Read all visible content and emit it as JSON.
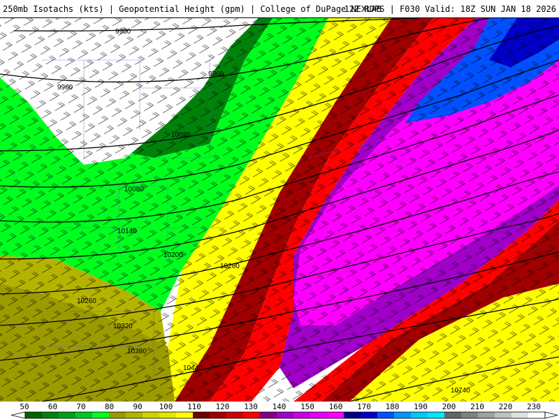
{
  "header": {
    "title_left": "250mb Isotachs (kts) | Geopotential Height (gpm) | College of DuPage NEXLAB",
    "title_right": "12Z RDPS | F030 Valid: 18Z SUN JAN 18 2026"
  },
  "legend": {
    "labels": [
      "50",
      "60",
      "70",
      "80",
      "90",
      "100",
      "110",
      "120",
      "130",
      "140",
      "150",
      "160",
      "170",
      "180",
      "190",
      "200",
      "210",
      "220",
      "230"
    ],
    "colors": [
      "#006400",
      "#00820a",
      "#00a014",
      "#00c81e",
      "#00ff1e",
      "#9b9b00",
      "#b4b400",
      "#d2d200",
      "#e6e600",
      "#ffff00",
      "#6e0000",
      "#a00000",
      "#d20000",
      "#ff0000",
      "#800080",
      "#a000c8",
      "#c800e6",
      "#e600ff",
      "#ff00ff",
      "#000080",
      "#0000c8",
      "#0050ff",
      "#0096ff",
      "#00c8ff",
      "#00e6ff",
      "#646464",
      "#808080",
      "#a0a0a0",
      "#c0c0c0",
      "#e0e0e0",
      "#ffffff"
    ]
  },
  "contours": {
    "labels": [
      "9900",
      "9960",
      "9960",
      "10020",
      "10080",
      "10140",
      "10200",
      "10260",
      "10260",
      "10320",
      "10380",
      "10440",
      "10740"
    ]
  }
}
